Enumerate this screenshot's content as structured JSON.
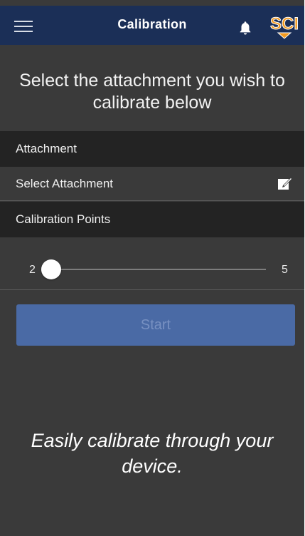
{
  "header": {
    "title": "Calibration",
    "menu_icon": "hamburger-menu-icon",
    "notification_icon": "bell-icon",
    "logo_text": "SCI",
    "colors": {
      "bar": "#1b2f57",
      "logo": "#f39a1f"
    }
  },
  "headline": "Select the attachment you wish to calibrate below",
  "attachment_section": {
    "header": "Attachment",
    "select_label": "Select Attachment",
    "edit_icon": "edit-icon"
  },
  "calibration_section": {
    "header": "Calibration Points",
    "slider": {
      "min_label": "2",
      "max_label": "5",
      "value": 2,
      "min": 2,
      "max": 5
    }
  },
  "start_button": {
    "label": "Start",
    "color": "#4a6aa5"
  },
  "caption": "Easily calibrate through your device."
}
